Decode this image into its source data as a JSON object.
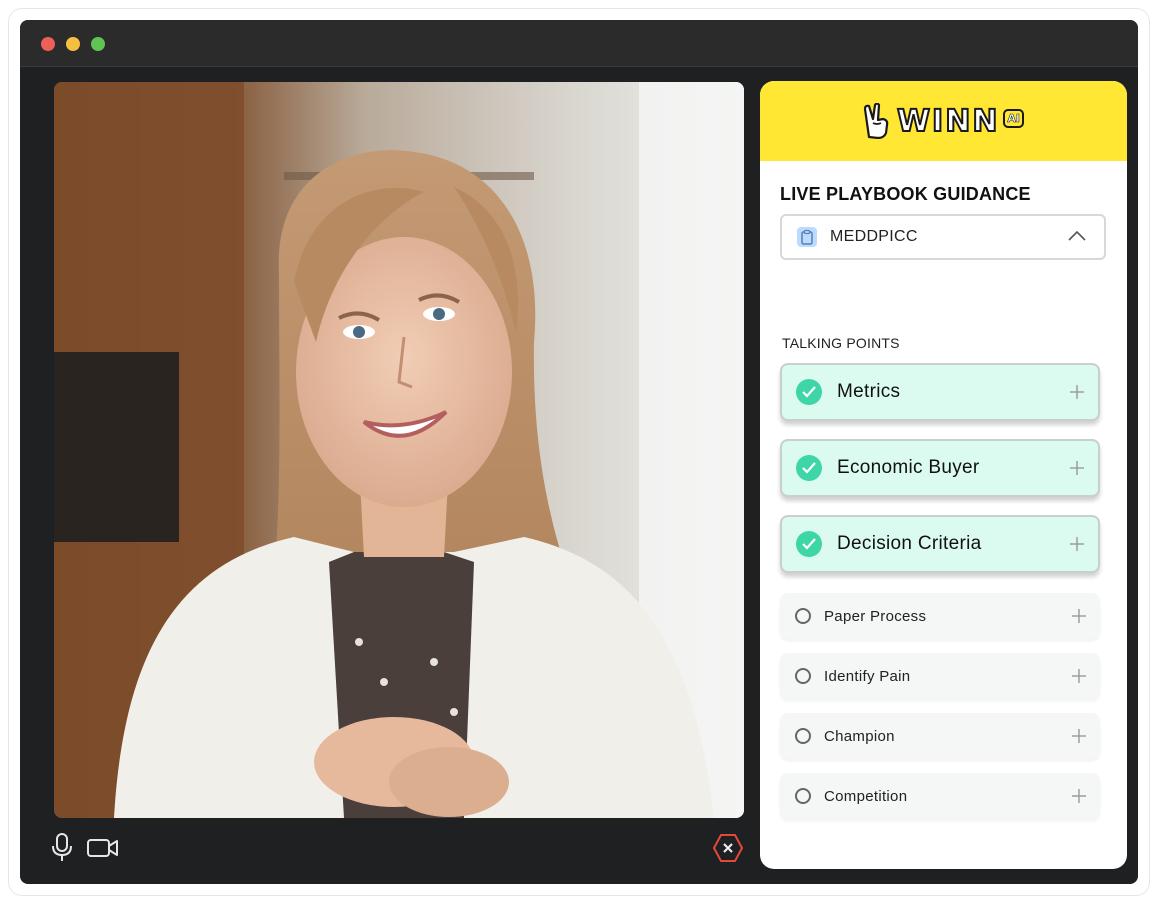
{
  "window": {
    "controls": [
      "close",
      "minimize",
      "maximize"
    ]
  },
  "call": {
    "controls": {
      "mic": "microphone-icon",
      "camera": "video-camera-icon",
      "end": "end-call-icon"
    },
    "colors": {
      "end_call": "#e5483b"
    }
  },
  "panel": {
    "brand": {
      "name": "WINN",
      "badge": "AI",
      "color": "#ffe733"
    },
    "title": "LIVE PLAYBOOK GUIDANCE",
    "playbook_select": {
      "value": "MEDDPICC",
      "icon": "clipboard-icon",
      "state": "expanded"
    },
    "section_label": "TALKING POINTS",
    "talking_points": [
      {
        "label": "Metrics",
        "completed": true
      },
      {
        "label": "Economic Buyer",
        "completed": true
      },
      {
        "label": "Decision Criteria",
        "completed": true
      },
      {
        "label": "Paper Process",
        "completed": false
      },
      {
        "label": "Identify Pain",
        "completed": false
      },
      {
        "label": "Champion",
        "completed": false
      },
      {
        "label": "Competition",
        "completed": false
      }
    ],
    "colors": {
      "check": "#3ed6a7",
      "done_bg": "#dcfbf0"
    }
  }
}
